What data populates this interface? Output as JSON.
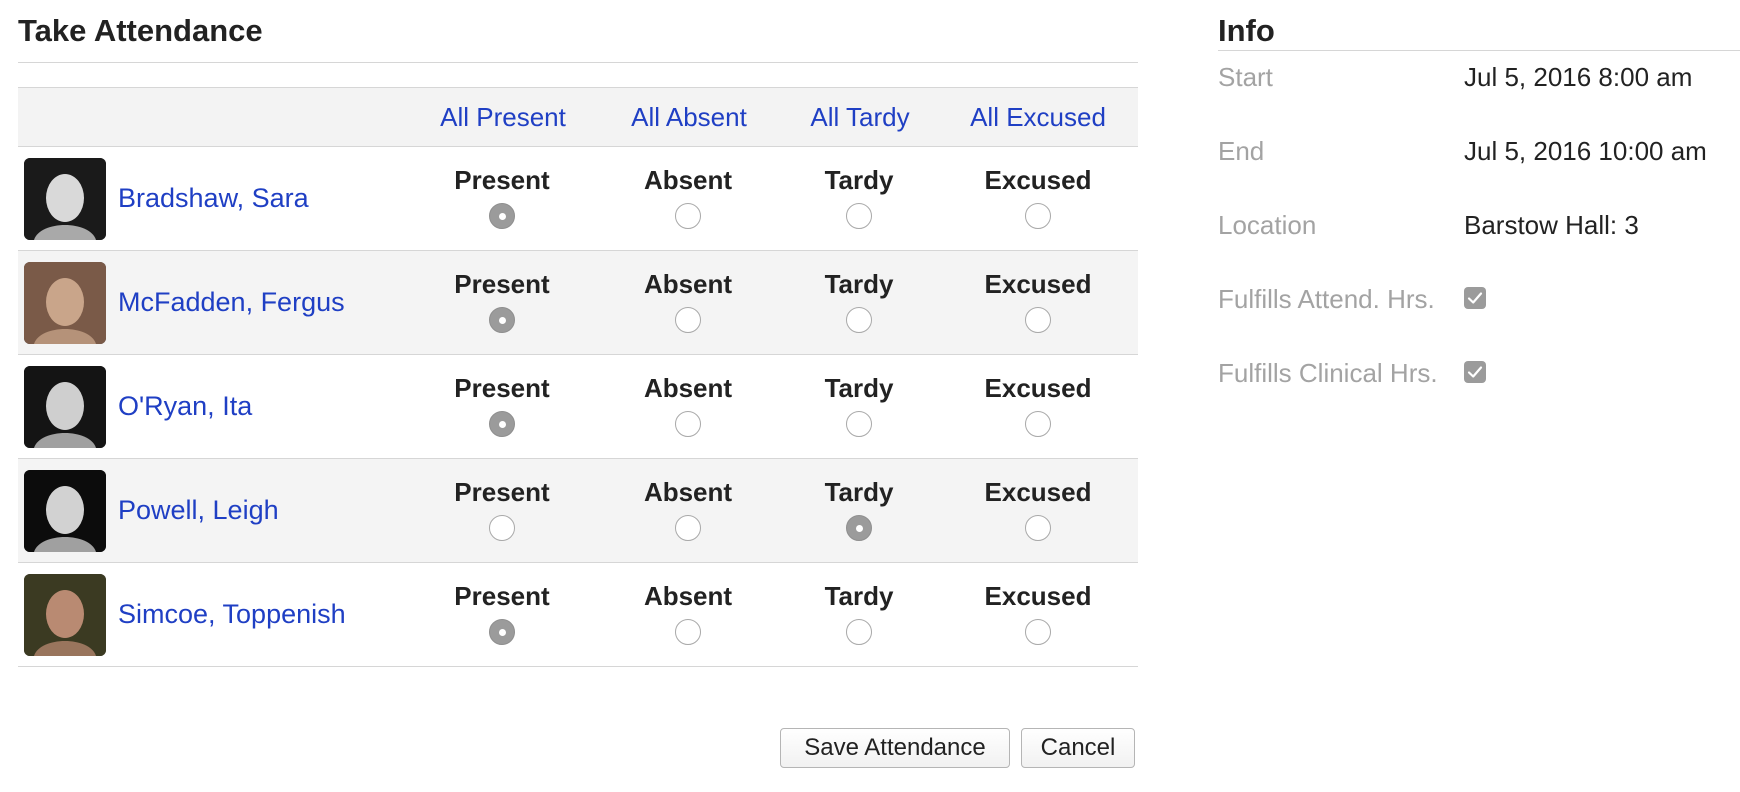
{
  "attendance": {
    "title": "Take Attendance",
    "bulk_actions": [
      {
        "label": "All Present"
      },
      {
        "label": "All Absent"
      },
      {
        "label": "All Tardy"
      },
      {
        "label": "All Excused"
      }
    ],
    "option_labels": [
      "Present",
      "Absent",
      "Tardy",
      "Excused"
    ],
    "students": [
      {
        "name": "Bradshaw, Sara",
        "selected": "Present",
        "avatar": "portrait-photo"
      },
      {
        "name": "McFadden, Fergus",
        "selected": "Present",
        "avatar": "portrait-photo"
      },
      {
        "name": "O'Ryan, Ita",
        "selected": "Present",
        "avatar": "portrait-photo"
      },
      {
        "name": "Powell, Leigh",
        "selected": "Tardy",
        "avatar": "portrait-photo"
      },
      {
        "name": "Simcoe, Toppenish",
        "selected": "Present",
        "avatar": "portrait-photo"
      }
    ],
    "save_label": "Save Attendance",
    "cancel_label": "Cancel"
  },
  "info": {
    "title": "Info",
    "start_label": "Start",
    "start_value": "Jul 5, 2016 8:00 am",
    "end_label": "End",
    "end_value": "Jul 5, 2016 10:00 am",
    "location_label": "Location",
    "location_value": "Barstow Hall: 3",
    "attend_hrs_label": "Fulfills Attend. Hrs.",
    "attend_hrs_checked": true,
    "clinical_hrs_label": "Fulfills Clinical Hrs.",
    "clinical_hrs_checked": true
  },
  "colors": {
    "link": "#1f3fc4",
    "muted": "#a3a3a3",
    "radio_checked": "#9b9b9b"
  }
}
